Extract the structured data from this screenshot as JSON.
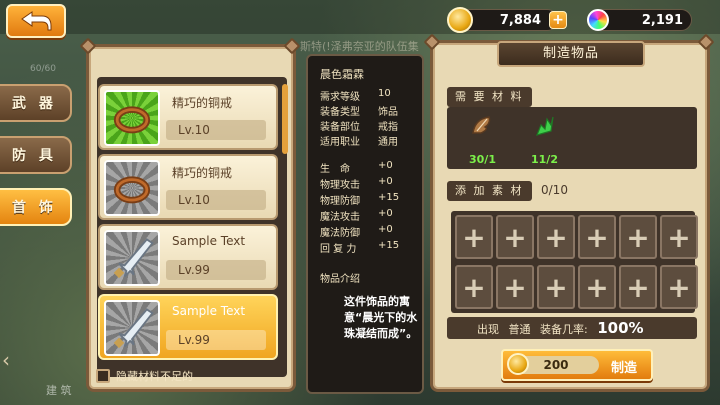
{
  "currency": {
    "gold": "7,884",
    "gems": "2,191",
    "plus": "+"
  },
  "background_text": {
    "top_notice": "斯特(!泽弗奈亚的队伍集",
    "left_counter": "60/60",
    "bottom_left": "建 筑"
  },
  "categories": [
    {
      "label": "武 器"
    },
    {
      "label": "防 具"
    },
    {
      "label": "首 饰"
    }
  ],
  "items": [
    {
      "name": "精巧的铜戒",
      "level": "Lv.10",
      "icon": "ring-icon",
      "rarity": "green"
    },
    {
      "name": "精巧的铜戒",
      "level": "Lv.10",
      "icon": "ring-icon",
      "rarity": "gray"
    },
    {
      "name": "Sample Text",
      "level": "Lv.99",
      "icon": "sword-icon",
      "rarity": "gray"
    },
    {
      "name": "Sample Text",
      "level": "Lv.99",
      "icon": "sword-icon",
      "rarity": "gray"
    }
  ],
  "hide_label": "隐藏材料不足的",
  "detail": {
    "title": "晨色霜霖",
    "attrs": [
      {
        "k": "需求等级",
        "v": "10"
      },
      {
        "k": "装备类型",
        "v": "饰品"
      },
      {
        "k": "装备部位",
        "v": "戒指"
      },
      {
        "k": "适用职业",
        "v": "通用"
      }
    ],
    "stats": [
      {
        "k": "生　命",
        "v": "+0"
      },
      {
        "k": "物理攻击",
        "v": "+0"
      },
      {
        "k": "物理防御",
        "v": "+15"
      },
      {
        "k": "魔法攻击",
        "v": "+0"
      },
      {
        "k": "魔法防御",
        "v": "+0"
      },
      {
        "k": "回 复 力",
        "v": "+15"
      }
    ],
    "intro_label": "物品介绍",
    "description": "这件饰品的寓意“晨光下的水珠凝结而成”。"
  },
  "craft": {
    "header": "制造物品",
    "materials_label": "需 要 材 料",
    "materials": [
      {
        "icon": "wing-material-icon",
        "count": "30/1",
        "color": "#b07a45"
      },
      {
        "icon": "leaf-material-icon",
        "count": "11/2",
        "color": "#3fcf4a"
      }
    ],
    "add_label": "添 加 素 材",
    "add_count": "0/10",
    "slot_symbol": "+",
    "rate_prefix": "出现",
    "rate_quality": "普通",
    "rate_label": "装备几率:",
    "rate_value": "100%",
    "cost": "200",
    "button_label": "制造"
  },
  "colors": {
    "accent": "#f0a520",
    "panel": "#e8d9b4",
    "dark": "#3f3329",
    "material_count": "#7cf04a"
  }
}
